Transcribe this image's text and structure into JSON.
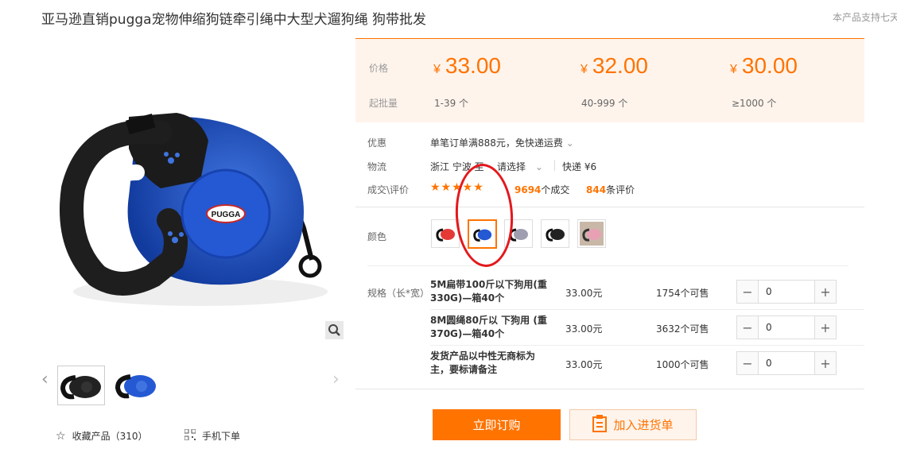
{
  "product": {
    "title": "亚马逊直销pugga宠物伸缩狗链牵引绳中大型犬遛狗绳 狗带批发",
    "side_note": "本产品支持七天"
  },
  "gallery": {
    "logo_text": "PUGGA",
    "thumbnails": [
      "black-leash-thumb",
      "blue-leash-thumb"
    ]
  },
  "prices": {
    "price_label": "价格",
    "moq_label": "起批量",
    "currency": "¥",
    "tiers": [
      {
        "price": "33.00",
        "qty": "1-39 个"
      },
      {
        "price": "32.00",
        "qty": "40-999 个"
      },
      {
        "price": "30.00",
        "qty": "≥1000 个"
      }
    ]
  },
  "info": {
    "promo_label": "优惠",
    "promo_text": "单笔订单满888元，免快递运费",
    "logistics_label": "物流",
    "logistics_from": "浙江 宁波",
    "logistics_to": "至",
    "logistics_select": "请选择",
    "logistics_method": "快递 ¥6",
    "deals_label": "成交\\评价",
    "stars": "★★★★★",
    "deals_count": "9694",
    "deals_unit": "个成交",
    "reviews_count": "844",
    "reviews_unit": "条评价"
  },
  "color": {
    "label": "颜色",
    "swatches": [
      "red",
      "blue",
      "gray",
      "black",
      "pink"
    ],
    "selected_index": 1
  },
  "specs": {
    "label": "规格（长*宽）",
    "rows": [
      {
        "name": "5M扁带100斤以下狗用(重330G)—箱40个",
        "price": "33.00元",
        "stock": "1754个可售",
        "qty": "0"
      },
      {
        "name": "8M圆绳80斤以 下狗用 (重370G)—箱40个",
        "price": "33.00元",
        "stock": "3632个可售",
        "qty": "0"
      },
      {
        "name": "发货产品以中性无商标为主，要标请备注",
        "price": "33.00元",
        "stock": "1000个可售",
        "qty": "0"
      }
    ]
  },
  "actions": {
    "buy_label": "立即订购",
    "cart_label": "加入进货单",
    "favorite_label": "收藏产品（310）",
    "mobile_label": "手机下单"
  },
  "colors": {
    "accent": "#ff7300",
    "price_bg": "#fff4ec",
    "annotation": "#e3181c"
  }
}
